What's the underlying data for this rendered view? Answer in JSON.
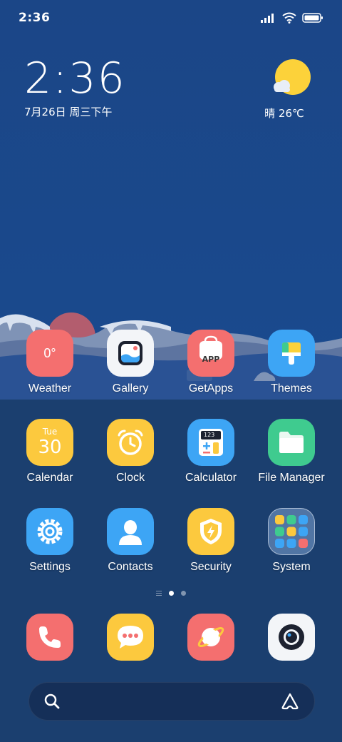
{
  "status_bar": {
    "time": "2:36",
    "icons": [
      "signal-icon",
      "wifi-icon",
      "battery-icon"
    ]
  },
  "clock_widget": {
    "time": "2:36",
    "date": "7月26日 周三下午"
  },
  "weather_widget": {
    "condition_icon": "sun-cloud-icon",
    "text": "晴 26℃"
  },
  "apps": [
    {
      "label": "Weather",
      "icon_text": "0°",
      "icon": "weather-icon",
      "color": "#f46f6f"
    },
    {
      "label": "Gallery",
      "icon": "gallery-icon",
      "color": "#f3f5f8"
    },
    {
      "label": "GetApps",
      "icon_text": "APP",
      "icon": "getapps-icon",
      "color": "#f46f6f"
    },
    {
      "label": "Themes",
      "icon": "themes-icon",
      "color": "#3da5f5"
    },
    {
      "label": "Calendar",
      "icon_day": "Tue",
      "icon_date": "30",
      "icon": "calendar-icon",
      "color": "#fcc93e"
    },
    {
      "label": "Clock",
      "icon": "clock-icon",
      "color": "#fcc93e"
    },
    {
      "label": "Calculator",
      "icon_text": "123",
      "icon": "calculator-icon",
      "color": "#3da5f5"
    },
    {
      "label": "File Manager",
      "icon": "folder-icon",
      "color": "#3fcb8f"
    },
    {
      "label": "Settings",
      "icon": "gear-icon",
      "color": "#3da5f5"
    },
    {
      "label": "Contacts",
      "icon": "contacts-icon",
      "color": "#3da5f5"
    },
    {
      "label": "Security",
      "icon": "security-icon",
      "color": "#fcc93e"
    },
    {
      "label": "System",
      "icon": "folder-system-icon",
      "color": "#7da2cf"
    }
  ],
  "page_indicator": {
    "total_pages": 2,
    "active_page": 1
  },
  "dock": [
    {
      "icon": "phone-icon",
      "color": "#f46f6f"
    },
    {
      "icon": "messages-icon",
      "color": "#fcc93e"
    },
    {
      "icon": "browser-icon",
      "color": "#f46f6f"
    },
    {
      "icon": "camera-icon",
      "color": "#f3f5f8"
    }
  ],
  "search_bar": {
    "left_icon": "search-icon",
    "right_icon": "assistant-icon"
  }
}
